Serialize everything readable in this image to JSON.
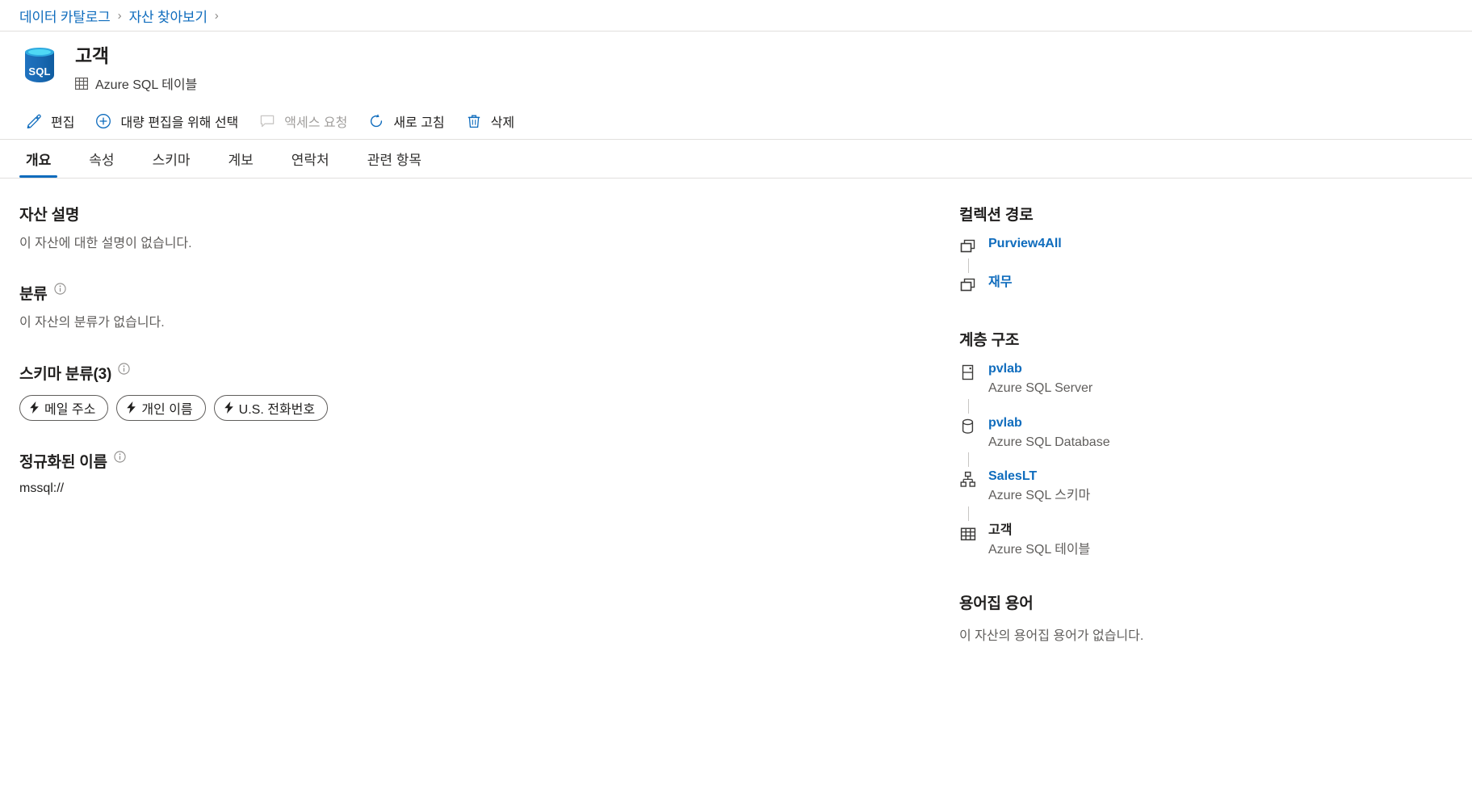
{
  "breadcrumb": {
    "items": [
      {
        "label": "데이터 카탈로그"
      },
      {
        "label": "자산 찾아보기"
      }
    ],
    "separator": "›"
  },
  "asset": {
    "name": "고객",
    "type_label": "Azure SQL 테이블",
    "type_icon": "table-grid-icon",
    "source_icon": "azure-sql-icon",
    "source_icon_text": "SQL"
  },
  "commands": [
    {
      "id": "edit",
      "label": "편집",
      "icon": "pencil-icon",
      "disabled": false
    },
    {
      "id": "bulk-edit",
      "label": "대량 편집을 위해 선택",
      "icon": "circle-plus-icon",
      "disabled": false
    },
    {
      "id": "request-access",
      "label": "액세스 요청",
      "icon": "comment-icon",
      "disabled": true
    },
    {
      "id": "refresh",
      "label": "새로 고침",
      "icon": "refresh-icon",
      "disabled": false
    },
    {
      "id": "delete",
      "label": "삭제",
      "icon": "trash-icon",
      "disabled": false
    }
  ],
  "tabs": [
    {
      "id": "overview",
      "label": "개요",
      "active": true
    },
    {
      "id": "properties",
      "label": "속성",
      "active": false
    },
    {
      "id": "schema",
      "label": "스키마",
      "active": false
    },
    {
      "id": "lineage",
      "label": "계보",
      "active": false
    },
    {
      "id": "contacts",
      "label": "연락처",
      "active": false
    },
    {
      "id": "related",
      "label": "관련 항목",
      "active": false
    }
  ],
  "main": {
    "description": {
      "title": "자산 설명",
      "empty_text": "이 자산에 대한 설명이 없습니다."
    },
    "classification": {
      "title": "분류",
      "empty_text": "이 자산의 분류가 없습니다."
    },
    "schema_classification": {
      "title": "스키마 분류(3)",
      "count": 3,
      "pills": [
        {
          "label": "메일 주소",
          "icon": "bolt-icon"
        },
        {
          "label": "개인 이름",
          "icon": "bolt-icon"
        },
        {
          "label": "U.S. 전화번호",
          "icon": "bolt-icon"
        }
      ]
    },
    "qualified_name": {
      "title": "정규화된 이름",
      "value": "mssql://"
    }
  },
  "side": {
    "collection_path": {
      "title": "컬렉션 경로",
      "nodes": [
        {
          "label": "Purview4All",
          "icon": "collection-icon",
          "link": true
        },
        {
          "label": "재무",
          "icon": "collection-icon",
          "link": true
        }
      ]
    },
    "hierarchy": {
      "title": "계층 구조",
      "nodes": [
        {
          "label": "pvlab",
          "sub": "Azure SQL Server",
          "icon": "server-icon",
          "link": true
        },
        {
          "label": "pvlab",
          "sub": "Azure SQL Database",
          "icon": "database-icon",
          "link": true
        },
        {
          "label": "SalesLT",
          "sub": "Azure SQL 스키마",
          "icon": "schema-icon",
          "link": true
        },
        {
          "label": "고객",
          "sub": "Azure SQL 테이블",
          "icon": "table-icon",
          "link": false
        }
      ]
    },
    "glossary": {
      "title": "용어집 용어",
      "empty_text": "이 자산의 용어집 용어가 없습니다."
    }
  },
  "colors": {
    "accent": "#0f6cbd",
    "text_primary": "#201f1e",
    "text_secondary": "#605e5c",
    "disabled": "#a19f9d",
    "divider": "#e1dfdd"
  }
}
